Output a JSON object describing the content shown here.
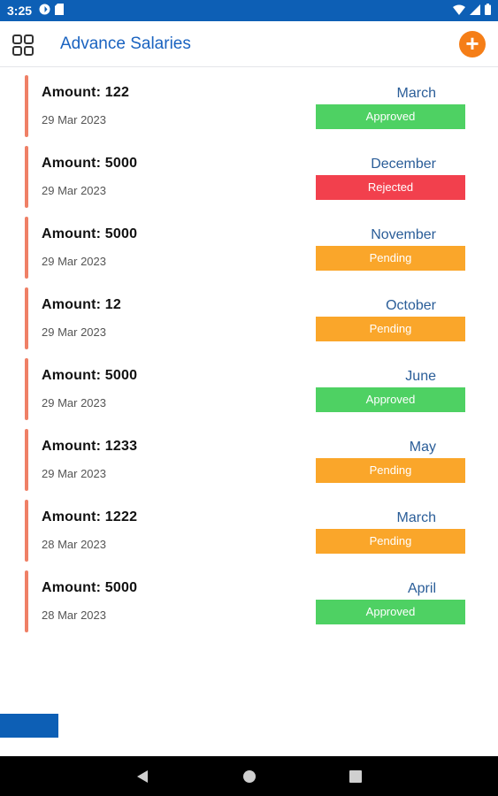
{
  "status_bar": {
    "time": "3:25",
    "icons": [
      "app-notification-icon",
      "sd-card-icon",
      "wifi-icon",
      "signal-icon",
      "battery-icon"
    ]
  },
  "app_bar": {
    "title": "Advance Salaries",
    "menu_icon": "grid-menu-icon",
    "add_icon": "plus-icon",
    "add_label": "+"
  },
  "colors": {
    "primary": "#0d5fb5",
    "title": "#1a63c0",
    "accent": "#f57e17",
    "card_accent": "#ef8066",
    "approved": "#4ed163",
    "rejected": "#f2404d",
    "pending": "#faa62a"
  },
  "salaries": [
    {
      "amount": "Amount: 122",
      "date": "29 Mar 2023",
      "month": "March",
      "status": "Approved"
    },
    {
      "amount": "Amount: 5000",
      "date": "29 Mar 2023",
      "month": "December",
      "status": "Rejected"
    },
    {
      "amount": "Amount: 5000",
      "date": "29 Mar 2023",
      "month": "November",
      "status": "Pending"
    },
    {
      "amount": "Amount: 12",
      "date": "29 Mar 2023",
      "month": "October",
      "status": "Pending"
    },
    {
      "amount": "Amount: 5000",
      "date": "29 Mar 2023",
      "month": "June",
      "status": "Approved"
    },
    {
      "amount": "Amount: 1233",
      "date": "29 Mar 2023",
      "month": "May",
      "status": "Pending"
    },
    {
      "amount": "Amount: 1222",
      "date": "28 Mar 2023",
      "month": "March",
      "status": "Pending"
    },
    {
      "amount": "Amount: 5000",
      "date": "28 Mar 2023",
      "month": "April",
      "status": "Approved"
    }
  ],
  "nav_bar": {
    "icons": [
      "back-icon",
      "home-icon",
      "recents-icon"
    ]
  }
}
